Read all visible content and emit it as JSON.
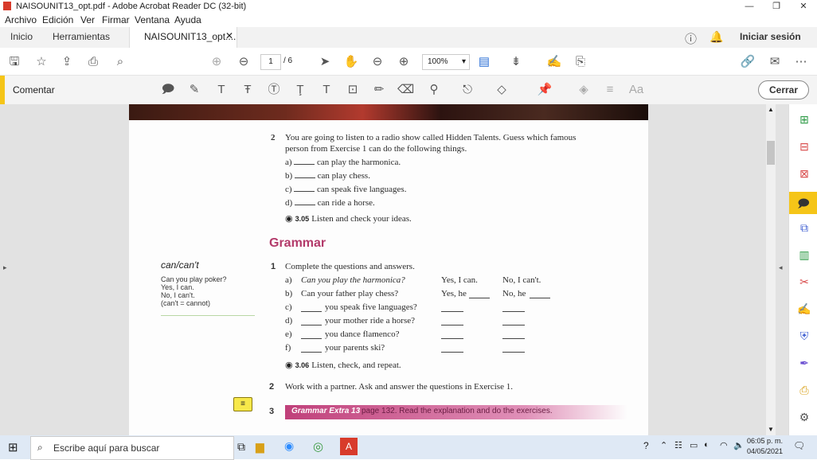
{
  "window": {
    "title": "NAISOUNIT13_opt.pdf - Adobe Acrobat Reader DC (32-bit)",
    "controls": [
      "—",
      "❐",
      "✕"
    ]
  },
  "menu": [
    "Archivo",
    "Edición",
    "Ver",
    "Firmar",
    "Ventana",
    "Ayuda"
  ],
  "tabs": {
    "home": "Inicio",
    "tools": "Herramientas",
    "doc": "NAISOUNIT13_opt....",
    "signin": "Iniciar sesión"
  },
  "toolbar": {
    "page_current": "1",
    "page_total": "/ 6",
    "zoom": "100%"
  },
  "comment_bar": {
    "label": "Comentar",
    "close": "Cerrar"
  },
  "document": {
    "ex2_num": "2",
    "ex2_line1": "You are going to listen to a radio show called Hidden Talents. Guess which famous",
    "ex2_line2": "person from Exercise 1 can do the following things.",
    "ex2_items": [
      {
        "letter": "a)",
        "text": "can play the harmonica."
      },
      {
        "letter": "b)",
        "text": "can play chess."
      },
      {
        "letter": "c)",
        "text": "can speak five languages."
      },
      {
        "letter": "d)",
        "text": "can ride a horse."
      }
    ],
    "ex2_audio": "3.05",
    "ex2_listen": "Listen and check your ideas.",
    "grammar_title": "Grammar",
    "side": {
      "heading": "can/can't",
      "lines": [
        "Can you play poker?",
        "Yes, I can.",
        "No, I can't.",
        "(can't = cannot)"
      ]
    },
    "g1_num": "1",
    "g1_instr": "Complete the questions and answers.",
    "g1_rows": [
      {
        "letter": "a)",
        "q": "Can you play the harmonica?",
        "yes": "Yes, I can.",
        "no": "No, I can't."
      },
      {
        "letter": "b)",
        "q": "Can your father play chess?",
        "yes": "Yes, he",
        "no": "No, he"
      },
      {
        "letter": "c)",
        "q": "you speak five languages?",
        "yes": "",
        "no": ""
      },
      {
        "letter": "d)",
        "q": "your mother ride a horse?",
        "yes": "",
        "no": ""
      },
      {
        "letter": "e)",
        "q": "you dance flamenco?",
        "yes": "",
        "no": ""
      },
      {
        "letter": "f)",
        "q": "your parents ski?",
        "yes": "",
        "no": ""
      }
    ],
    "g1_audio": "3.06",
    "g1_listen": "Listen, check, and repeat.",
    "g2_num": "2",
    "g2_text": "Work with a partner. Ask and answer the questions in Exercise 1.",
    "g3_num": "3",
    "g3_band": "Grammar Extra 13",
    "g3_text": "page 132. Read the explanation and do the exercises."
  },
  "taskbar": {
    "search_placeholder": "Escribe aquí para buscar",
    "time": "06:05 p. m.",
    "date": "04/05/2021"
  }
}
